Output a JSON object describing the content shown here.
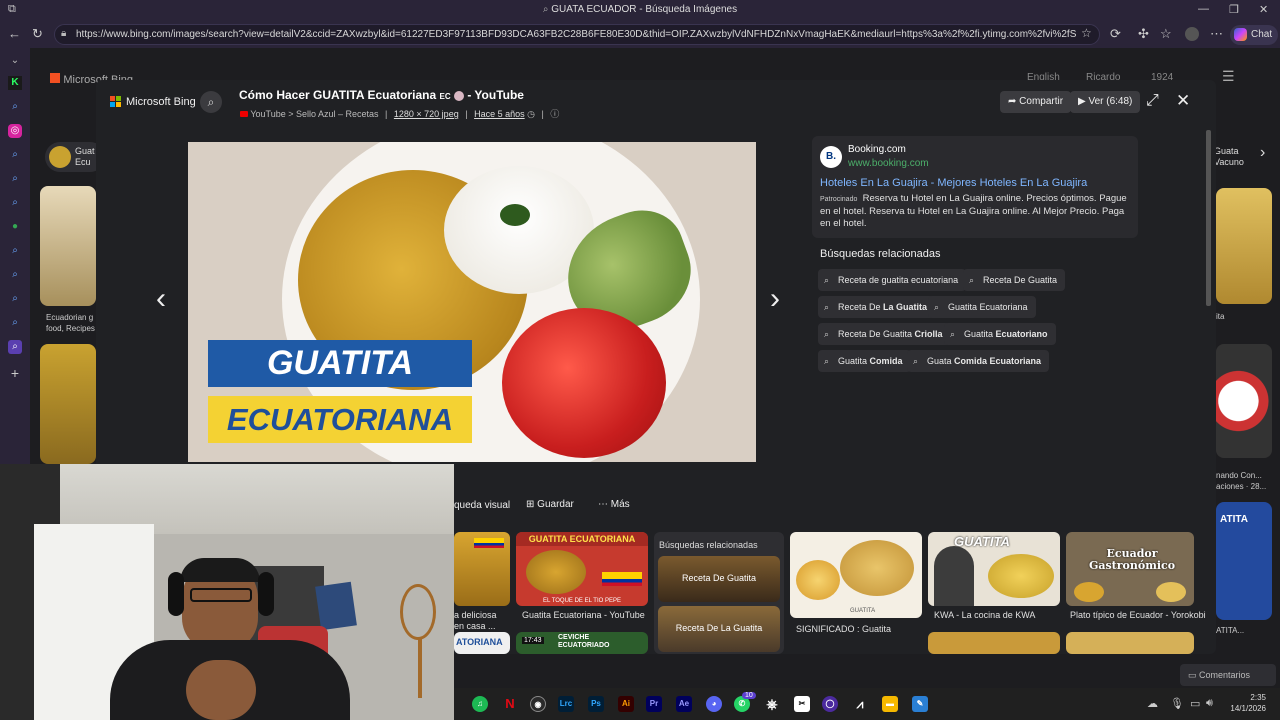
{
  "window": {
    "title": "GUATA ECUADOR - Búsqueda Imágenes",
    "url": "https://www.bing.com/images/search?view=detailV2&ccid=ZAXwzbyl&id=61227ED3F97113BFD93DCA63FB2C28B6FE80E30D&thid=OIP.ZAXwzbylVdNFHDZnNxVmagHaEK&mediaurl=https%3a%2f%2fi.ytimg.com%2fvi%2fSG6Eo4pqtZo%2fm...",
    "chat_label": "Chat"
  },
  "bg": {
    "logo": "Microsoft Bing",
    "lang": "English",
    "user": "Ricardo",
    "points": "1924",
    "left_tag": "Guat Ecu",
    "right_tag": "Guata Vacuno",
    "left_caption1": "Ecuadorian g",
    "left_caption2": "food, Recipes",
    "right_caption1": "ita",
    "right_caption2": "nando Con...",
    "right_caption3": "aciones · 28...",
    "right_caption4": "ATITA...",
    "comments": "Comentarios"
  },
  "modal": {
    "logo": "Microsoft Bing",
    "title": "Cómo Hacer GUATITA Ecuatoriana",
    "title_flag": "EC",
    "title_suffix": "- YouTube",
    "source": "YouTube > Sello Azul – Recetas",
    "dims": "1280 × 720 jpeg",
    "age": "Hace 5 años",
    "share": "Compartir",
    "watch": "Ver (6:48)",
    "banner_top": "GUATITA",
    "banner_bottom": "ECUATORIANA"
  },
  "ad": {
    "site": "Booking.com",
    "domain": "www.booking.com",
    "headline": "Hoteles En La Guajira - Mejores Hoteles En La Guajira",
    "sponsored": "Patrocinado",
    "text": "Reserva tu Hotel en La Guajira online. Precios óptimos. Pague en el hotel. Reserva tu Hotel en La Guajira online. Al Mejor Precio. Paga en el hotel."
  },
  "related": {
    "heading": "Búsquedas relacionadas",
    "chips": [
      {
        "a": "Receta de guatita ecuatoriana",
        "b": ""
      },
      {
        "a": "Receta De Guatita",
        "b": ""
      },
      {
        "a": "Receta De ",
        "b": "La Guatita"
      },
      {
        "a": "Guatita Ecuatoriana",
        "b": ""
      },
      {
        "a": "Receta De Guatita ",
        "b": "Criolla"
      },
      {
        "a": "Guatita ",
        "b": "Ecuatoriano"
      },
      {
        "a": "Guatita ",
        "b": "Comida"
      },
      {
        "a": "Guata ",
        "b": "Comida Ecuatoriana"
      }
    ]
  },
  "actions": {
    "visual": "queda visual",
    "save": "Guardar",
    "more": "Más"
  },
  "strip": {
    "cap1a": "a deliciosa",
    "cap1b": "en casa ...",
    "cap2": "Guatita Ecuatoriana - YouTube",
    "thumb2_title": "GUATITA ECUATORIANA",
    "thumb2_sub": "EL TOQUE DE EL TIO PEPE",
    "thumb2_time": "17:43",
    "thumb2b": "CEVICHE ECUATORIADO",
    "rel_heading": "Búsquedas relacionadas",
    "rel1": "Receta De Guatita",
    "rel2": "Receta De La Guatita",
    "cap4": "SIGNIFICADO : Guatita",
    "thumb4_tag": "GUATITA",
    "cap5": "KWA - La cocina de KWA",
    "thumb5_title": "GUATITA",
    "cap6": "Plato típico de Ecuador - Yorokobi",
    "thumb6_title": "Ecuador Gastronómico",
    "thumb0_tag": "ATORIANA"
  },
  "taskbar": {
    "badge": "10",
    "time": "2:35",
    "date": "14/1/2026",
    "apps": [
      "Lrc",
      "Ps",
      "Ai",
      "Pr",
      "Ae"
    ]
  }
}
